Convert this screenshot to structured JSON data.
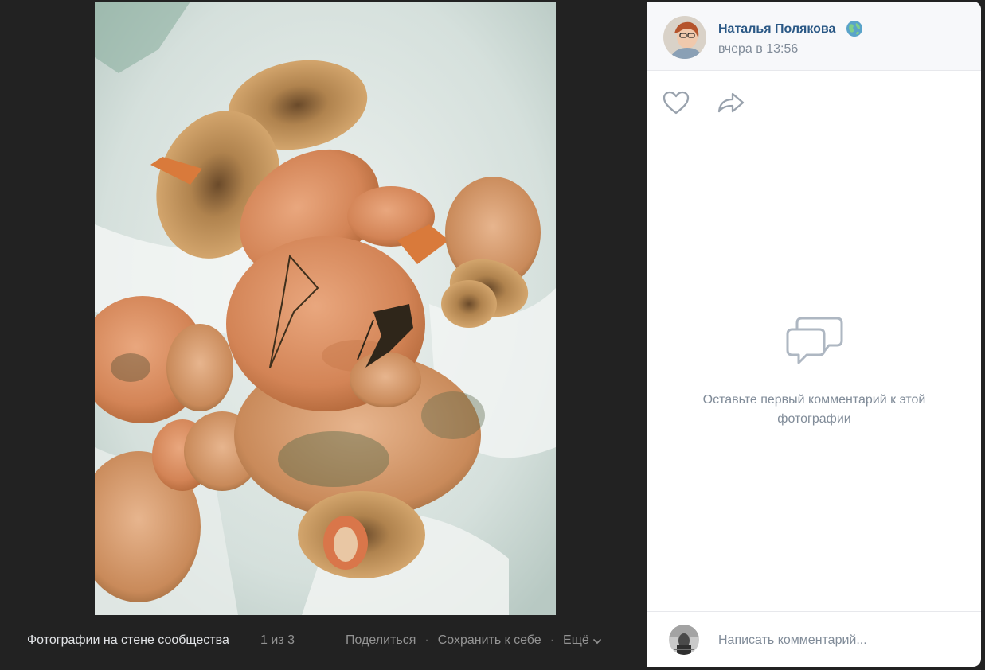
{
  "viewer": {
    "album_title": "Фотографии на стене сообщества",
    "counter": "1 из 3",
    "actions": {
      "share": "Поделиться",
      "save": "Сохранить к себе",
      "more": "Ещё",
      "separator": "·"
    }
  },
  "author": {
    "name": "Наталья Полякова",
    "time": "вчера в 13:56"
  },
  "comments": {
    "empty_text": "Оставьте первый комментарий к этой фотографии",
    "input_placeholder": "Написать комментарий..."
  },
  "icons": {
    "like": "heart-icon",
    "share": "share-arrow-icon",
    "empty": "comments-bubbles-icon",
    "more": "chevron-down-icon",
    "status": "globe-icon"
  },
  "colors": {
    "viewer_bg": "#222222",
    "link": "#2a5885",
    "muted": "#818c99",
    "icon": "#99a2ad"
  }
}
